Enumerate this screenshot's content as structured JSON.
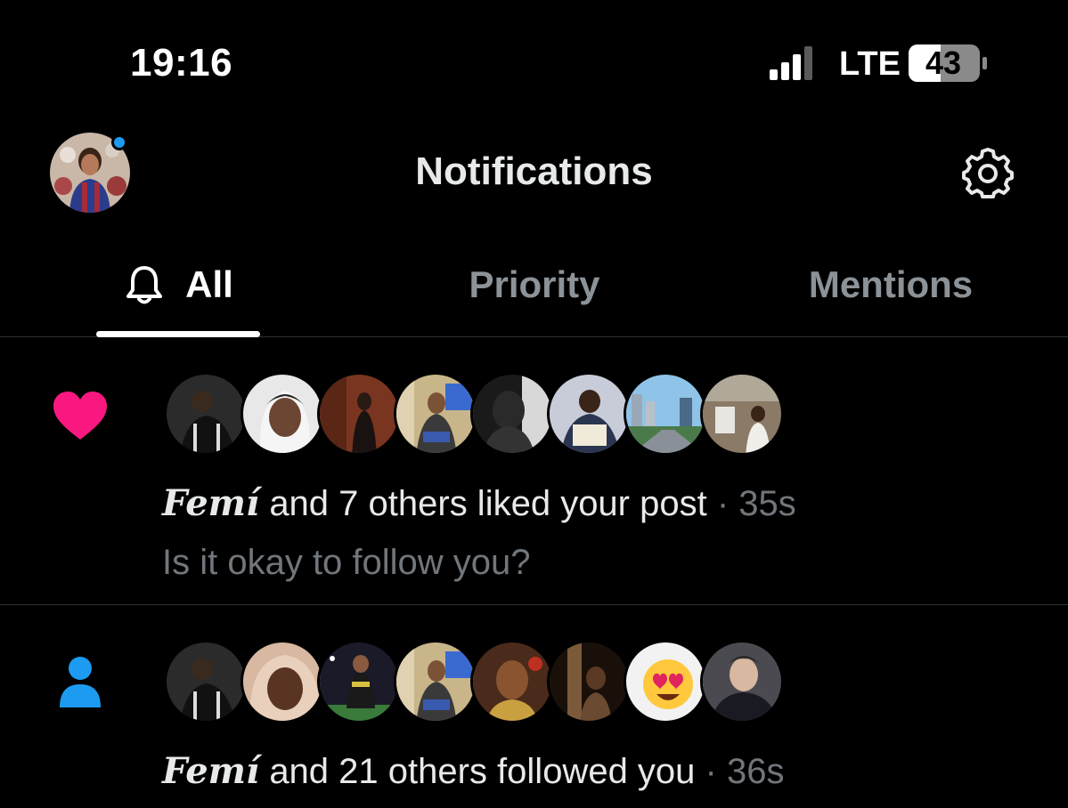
{
  "status_bar": {
    "time": "19:16",
    "network": "LTE",
    "battery": "43",
    "icons": [
      "signal-bars-icon",
      "battery-icon"
    ]
  },
  "header": {
    "title": "Notifications",
    "icons": [
      "profile-avatar",
      "gear-icon"
    ],
    "accent_color": "#1d9bf0"
  },
  "tabs": [
    {
      "label": "All",
      "active": true,
      "icon": "bell-icon"
    },
    {
      "label": "Priority",
      "active": false
    },
    {
      "label": "Mentions",
      "active": false
    }
  ],
  "notifications": [
    {
      "type": "like",
      "icon": "heart-icon",
      "icon_color": "#f91880",
      "actor": "Femí",
      "text": "and 7 others liked your post",
      "time": "· 35s",
      "preview": "Is it okay to follow you?",
      "avatar_count": 8
    },
    {
      "type": "follow",
      "icon": "person-icon",
      "icon_color": "#1d9bf0",
      "actor": "Femí",
      "text": "and 21 others followed you",
      "time": "· 36s",
      "avatar_count": 8
    }
  ]
}
